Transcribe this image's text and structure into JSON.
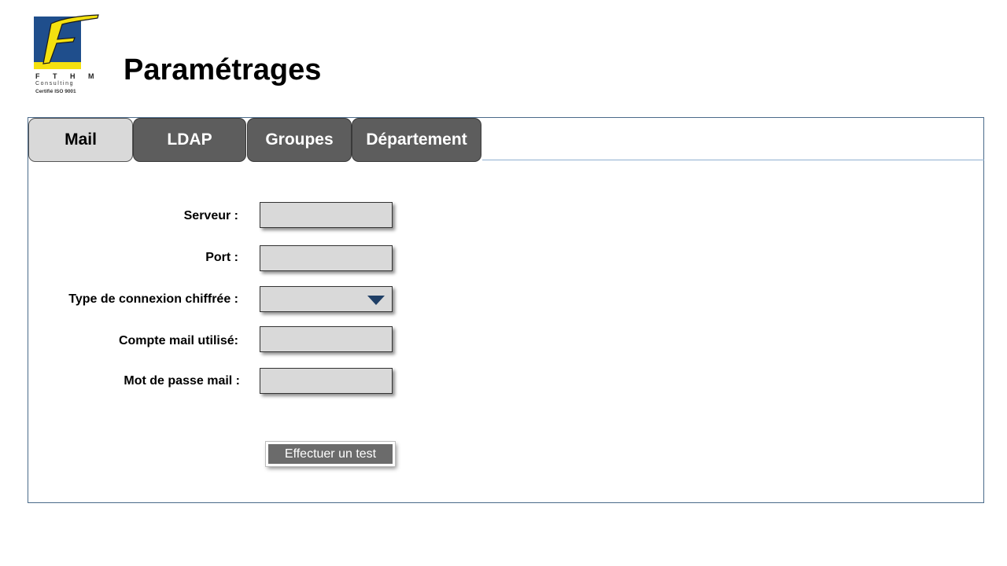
{
  "logo": {
    "letter": "F",
    "brand": "F T H M",
    "tagline": "Consulting",
    "certification": "Certifié ISO 9001",
    "colors": {
      "blue": "#1f4e8c",
      "yellow": "#f4e10f"
    }
  },
  "page": {
    "title": "Paramétrages"
  },
  "tabs": [
    {
      "label": "Mail",
      "active": true
    },
    {
      "label": "LDAP",
      "active": false
    },
    {
      "label": "Groupes",
      "active": false
    },
    {
      "label": "Département",
      "active": false
    }
  ],
  "form": {
    "server": {
      "label": "Serveur :",
      "value": ""
    },
    "port": {
      "label": "Port :",
      "value": ""
    },
    "encryption": {
      "label": "Type de connexion chiffrée :",
      "value": "",
      "icon": "chevron-down-icon"
    },
    "account": {
      "label": "Compte mail utilisé:",
      "value": ""
    },
    "password": {
      "label": "Mot de passe mail :",
      "value": ""
    }
  },
  "actions": {
    "test_label": "Effectuer un test"
  },
  "colors": {
    "tab_inactive": "#5d5d5d",
    "tab_active": "#d9d9d9",
    "field": "#d9d9d9",
    "panel_border": "#4a6a8a"
  }
}
